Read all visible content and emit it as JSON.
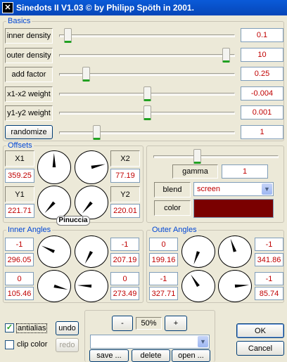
{
  "window": {
    "title": "Sinedots II V1.03 © by Philipp Spöth in 2001.",
    "icon": "sinedots-icon"
  },
  "basics": {
    "legend": "Basics",
    "rows": [
      {
        "label": "inner density",
        "value": "0.1",
        "slider": 0.03
      },
      {
        "label": "outer density",
        "value": "10",
        "slider": 0.97
      },
      {
        "label": "add factor",
        "value": "0.25",
        "slider": 0.14
      },
      {
        "label": "x1-x2 weight",
        "value": "-0.004",
        "slider": 0.5
      },
      {
        "label": "y1-y2 weight",
        "value": "0.001",
        "slider": 0.5
      },
      {
        "label": "randomize",
        "value": "1",
        "slider": 0.2
      }
    ]
  },
  "offsets": {
    "legend": "Offsets",
    "x1": {
      "label": "X1",
      "value": "359.25"
    },
    "x2": {
      "label": "X2",
      "value": "77.19"
    },
    "y1": {
      "label": "Y1",
      "value": "221.71"
    },
    "y2": {
      "label": "Y2",
      "value": "220.01"
    },
    "dial_angles": [
      359.25,
      77.19,
      221.71,
      220.01
    ],
    "watermark": "Pinuccia"
  },
  "right_panel": {
    "gamma_slider": 0.34,
    "gamma_label": "gamma",
    "gamma_value": "1",
    "blend_label": "blend",
    "blend_value": "screen",
    "color_label": "color",
    "color_swatch": "#7a0000"
  },
  "inner_angles": {
    "legend": "Inner Angles",
    "cells": [
      {
        "top": "-1",
        "bottom": "296.05",
        "angle": 296.05
      },
      {
        "top": "-1",
        "bottom": "207.19",
        "angle": 207.19
      },
      {
        "top": "0",
        "bottom": "105.46",
        "angle": 105.46
      },
      {
        "top": "0",
        "bottom": "273.49",
        "angle": 273.49
      }
    ]
  },
  "outer_angles": {
    "legend": "Outer Angles",
    "cells": [
      {
        "top": "0",
        "bottom": "199.16",
        "angle": 199.16
      },
      {
        "top": "-1",
        "bottom": "341.86",
        "angle": 341.86
      },
      {
        "top": "-1",
        "bottom": "327.71",
        "angle": 327.71
      },
      {
        "top": "-1",
        "bottom": "85.74",
        "angle": 85.74
      }
    ]
  },
  "bottom": {
    "antialias_label": "antialias",
    "antialias_checked": true,
    "clip_color_label": "clip color",
    "clip_color_checked": false,
    "undo_label": "undo",
    "redo_label": "redo",
    "zoom_minus": "-",
    "zoom_value": "50%",
    "zoom_plus": "+",
    "preset_value": "",
    "save_label": "save ...",
    "delete_label": "delete",
    "open_label": "open ...",
    "ok_label": "OK",
    "cancel_label": "Cancel"
  }
}
